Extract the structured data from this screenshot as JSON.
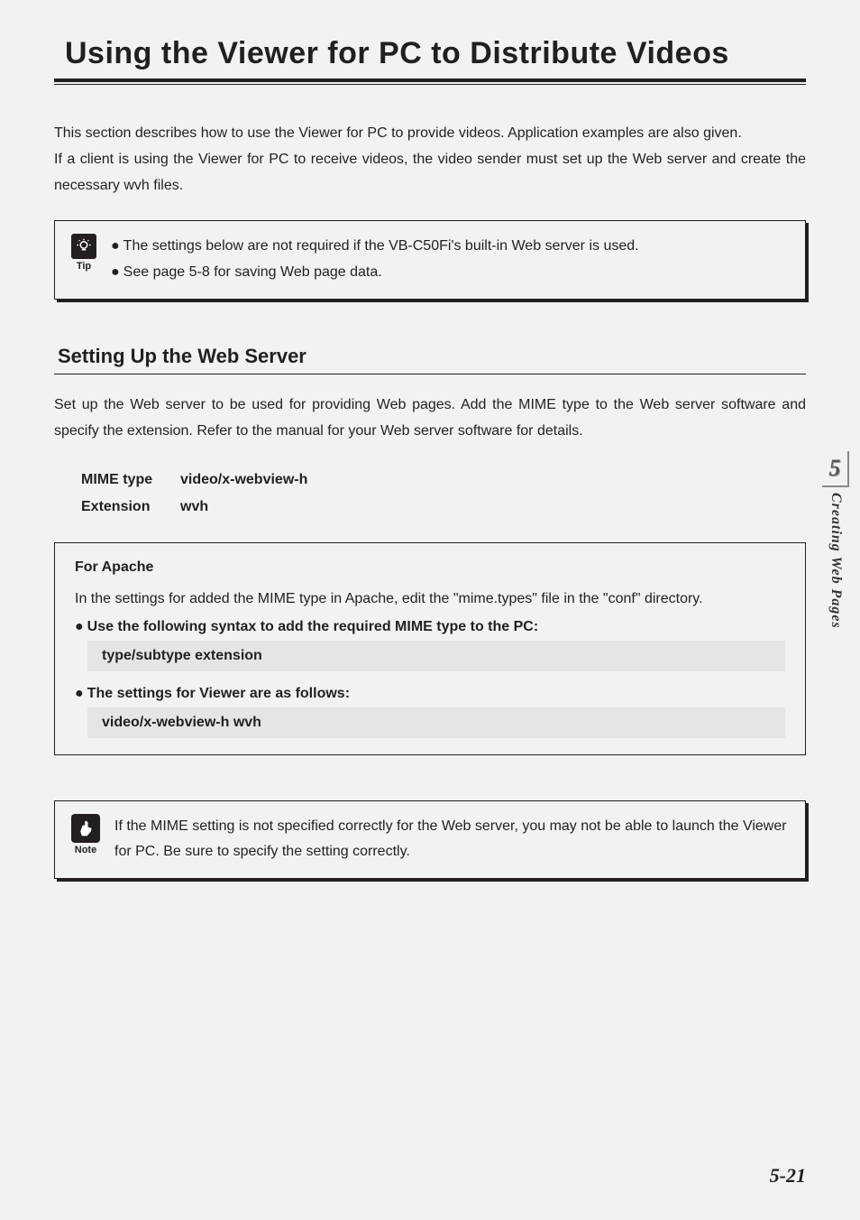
{
  "title": "Using the Viewer for PC to Distribute Videos",
  "intro": {
    "p1": "This section describes how to use the Viewer for PC to provide videos. Application examples are also given.",
    "p2": "If a client is using the Viewer for PC to receive videos, the video sender must set up the Web server and create the necessary wvh files."
  },
  "tip": {
    "label": "Tip",
    "line1": "The settings below are not required if the VB-C50Fi's built-in Web server is used.",
    "line2": "See page 5-8 for saving Web page data."
  },
  "section": {
    "heading": "Setting Up the Web Server",
    "intro": "Set up the Web server to be used for providing Web pages. Add the MIME type to the Web server software and specify the extension. Refer to the manual for your Web server software for details.",
    "kv": {
      "k1": "MIME type",
      "v1": "video/x-webview-h",
      "k2": "Extension",
      "v2": "wvh"
    },
    "apache": {
      "title": "For Apache",
      "desc": "In the settings for added the MIME type in Apache, edit the \"mime.types\" file in the \"conf\" directory.",
      "item1": "Use the following syntax to add the required MIME type to the PC:",
      "code1": "type/subtype extension",
      "item2": "The settings for Viewer are as follows:",
      "code2": "video/x-webview-h wvh"
    }
  },
  "note": {
    "label": "Note",
    "text": "If the MIME setting is not specified correctly for the Web server, you may not be able to launch the Viewer for PC. Be sure to specify the setting correctly."
  },
  "sidetab": {
    "num": "5",
    "text": "Creating Web Pages"
  },
  "pagenum": "5-21",
  "bullet": "●"
}
